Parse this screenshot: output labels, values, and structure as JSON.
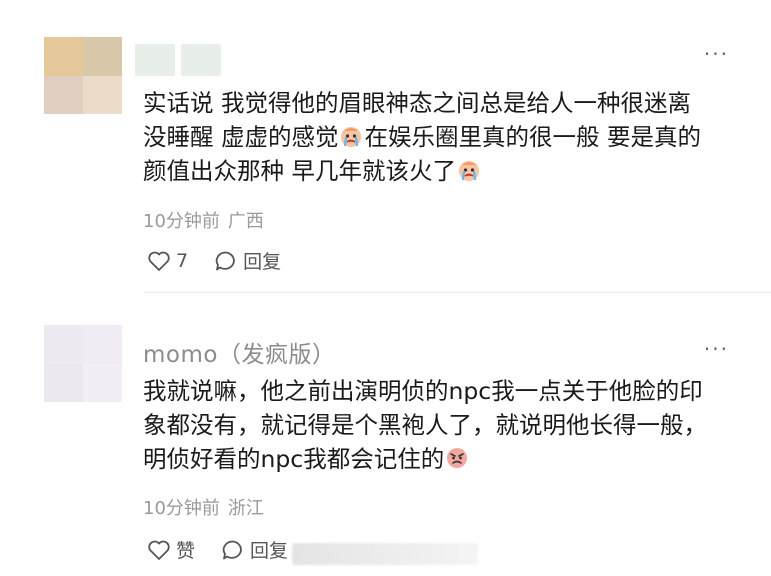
{
  "comments": [
    {
      "username": "",
      "avatar_colors": [
        "#e6c99a",
        "#d8c7a8",
        "#e0cfc0",
        "#eadcc8"
      ],
      "lines": [
        [
          "实话说 我觉得他的眉眼神态之间总是给人一种很迷离"
        ],
        [
          "没睡醒 虚虚的感觉",
          "在娱乐圈里真的很一般 要是真的"
        ],
        [
          "颜值出众那种 早几年就该火了",
          ""
        ]
      ],
      "time": "10分钟前",
      "location": "广西",
      "like_count": "7",
      "reply_label": "回复"
    },
    {
      "username": "momo（发疯版）",
      "avatar_colors": [
        "#efeaf2",
        "#f1ecf4",
        "#ece8f0",
        "#f2eef5"
      ],
      "lines": [
        [
          "我就说嘛，他之前出演明侦的npc我一点关于他脸的印"
        ],
        [
          "象都没有，就记得是个黑袍人了，就说明他长得一般，"
        ],
        [
          "明侦好看的npc我都会记住的",
          ""
        ]
      ],
      "time": "10分钟前",
      "location": "浙江",
      "like_label": "赞",
      "reply_label": "回复"
    }
  ],
  "more_label": "···",
  "icons": {
    "heart": "heart-icon",
    "reply": "reply-bubble-icon",
    "emoji_1": "crying-face-emoji",
    "emoji_2": "angry-face-emoji"
  }
}
